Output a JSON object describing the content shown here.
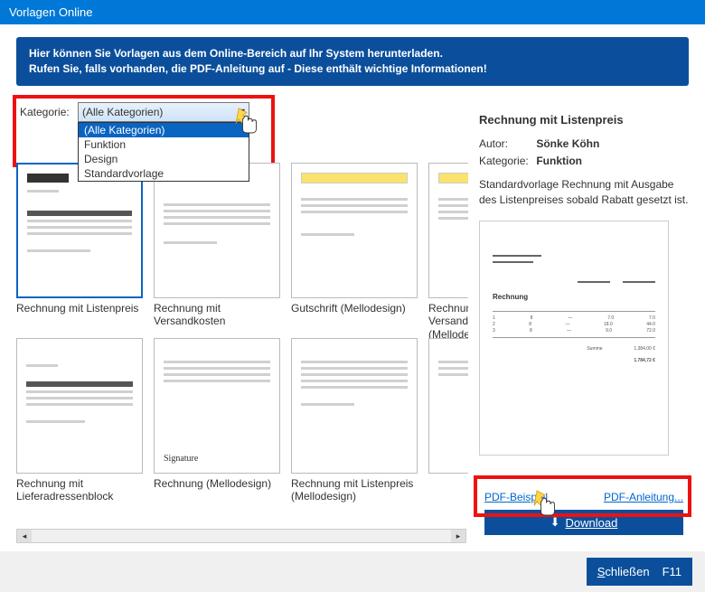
{
  "window": {
    "title": "Vorlagen Online"
  },
  "info": {
    "line1": "Hier können Sie Vorlagen aus dem Online-Bereich auf Ihr System herunterladen.",
    "line2": "Rufen Sie, falls vorhanden, die PDF-Anleitung auf - Diese enthält wichtige Informationen!"
  },
  "category": {
    "label": "Kategorie:",
    "selected": "(Alle Kategorien)",
    "options": [
      "(Alle Kategorien)",
      "Funktion",
      "Design",
      "Standardvorlage"
    ]
  },
  "templates": [
    {
      "name": "Rechnung mit Listenpreis",
      "selected": true
    },
    {
      "name": "Rechnung mit Versandkosten"
    },
    {
      "name": "Gutschrift (Mellodesign)"
    },
    {
      "name": "Rechnung mit Versandkosten (Mellodesign)"
    },
    {
      "name": "Rechnung mit Lieferadressenblock"
    },
    {
      "name": "Rechnung (Mellodesign)"
    },
    {
      "name": "Rechnung mit Listenpreis (Mellodesign)"
    },
    {
      "name": ""
    }
  ],
  "details": {
    "title": "Rechnung mit Listenpreis",
    "author_label": "Autor:",
    "author": "Sönke Köhn",
    "category_label": "Kategorie:",
    "category": "Funktion",
    "description": "Standardvorlage Rechnung mit Ausgabe des Listenpreises sobald Rabatt gesetzt ist.",
    "preview_heading": "Rechnung"
  },
  "links": {
    "pdf_example": "PDF-Beispiel",
    "pdf_instructions": "PDF-Anleitung..."
  },
  "buttons": {
    "download": "Download",
    "close": "Schließen",
    "close_key": "F11"
  }
}
